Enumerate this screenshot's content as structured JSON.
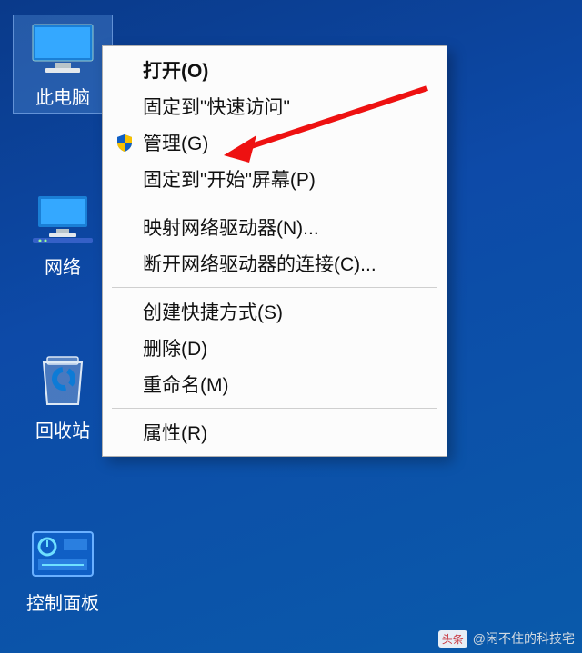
{
  "desktop": {
    "this_pc": "此电脑",
    "network": "网络",
    "recycle_bin": "回收站",
    "control_panel": "控制面板"
  },
  "context_menu": {
    "open": "打开(O)",
    "pin_quick_access": "固定到\"快速访问\"",
    "manage": "管理(G)",
    "pin_start": "固定到\"开始\"屏幕(P)",
    "map_drive": "映射网络驱动器(N)...",
    "disconnect_drive": "断开网络驱动器的连接(C)...",
    "create_shortcut": "创建快捷方式(S)",
    "delete": "删除(D)",
    "rename": "重命名(M)",
    "properties": "属性(R)"
  },
  "watermark": {
    "badge": "头条",
    "author": "@闲不住的科技宅"
  }
}
